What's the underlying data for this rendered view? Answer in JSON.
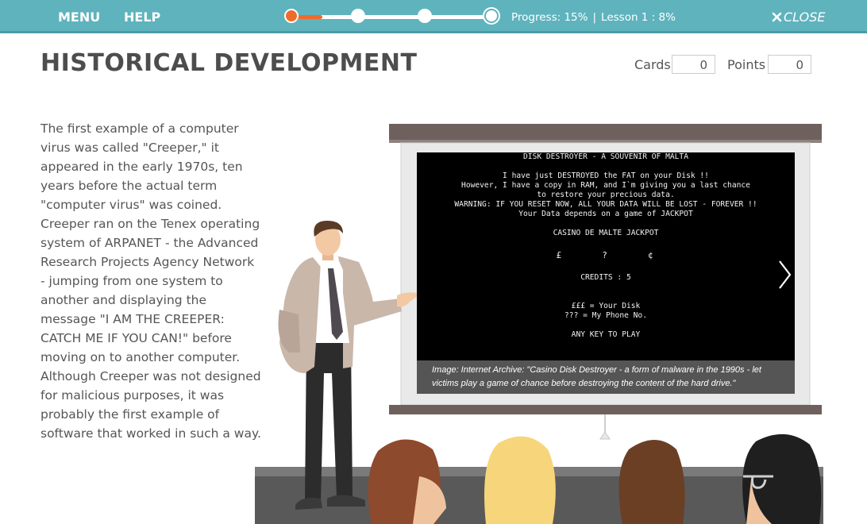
{
  "topbar": {
    "menu_label": "MENU",
    "help_label": "HELP",
    "progress_text": "Progress: 15%",
    "lesson_text": "Lesson 1 : 8%",
    "separator": "|",
    "progress_fraction": 0.15,
    "steps": 4,
    "current_step": 1,
    "close_label": "CLOSE",
    "close_icon": "close-x-icon",
    "colors": {
      "bar": "#5fb3bd",
      "accent": "#f06a2c"
    }
  },
  "header": {
    "title": "HISTORICAL DEVELOPMENT",
    "cards_label": "Cards",
    "cards_value": "0",
    "points_label": "Points",
    "points_value": "0"
  },
  "content": {
    "body": "The first example of a computer virus was called \"Creeper,\" it appeared in the early 1970s, ten years before the actual term \"computer virus\" was coined. Creeper ran on the Tenex operating system of ARPANET - the Advanced Research Projects Agency Network - jumping from one system to another and displaying the message \"I AM THE CREEPER: CATCH ME IF YOU CAN!\" before moving on to another computer. Although Creeper was not designed for malicious purposes, it was probably the first example of software that worked in such a way."
  },
  "slide": {
    "terminal_lines": [
      "DISK DESTROYER - A SOUVENIR OF MALTA",
      "",
      "I have just DESTROYED the FAT on your Disk !!",
      "However, I have a copy in RAM, and I`m giving you a last chance",
      "to restore your precious data.",
      "WARNING: IF YOU RESET NOW, ALL YOUR DATA WILL BE LOST - FOREVER !!",
      "Your Data depends on a game of JACKPOT",
      "",
      "CASINO DE MALTE JACKPOT",
      "",
      "£     ?     ¢",
      "",
      "CREDITS : 5",
      "",
      "",
      "£££ = Your Disk",
      "??? = My Phone No.",
      "",
      "ANY KEY TO PLAY"
    ],
    "caption": "Image: Internet Archive: \"Casino Disk Destroyer - a form of malware in the 1990s - let victims play a game of chance before destroying the content of the hard drive.\"",
    "next_icon": "chevron-right-icon"
  }
}
